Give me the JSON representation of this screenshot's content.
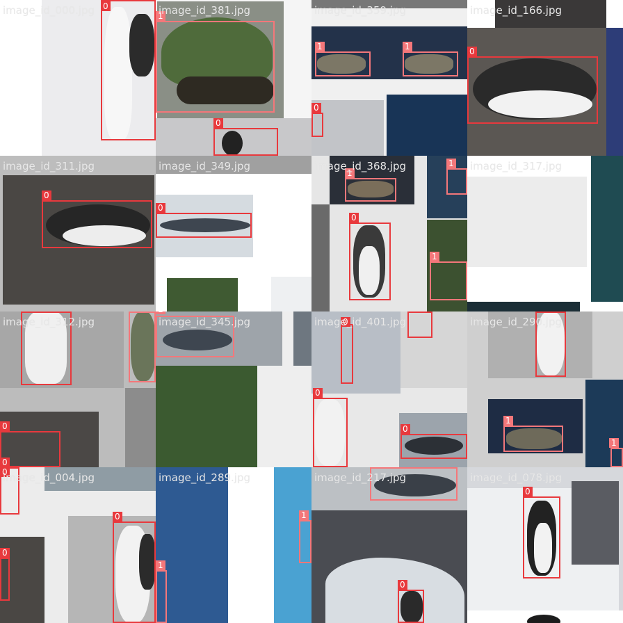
{
  "grid": {
    "tiles": [
      {
        "filename": "image_id_000.jpg"
      },
      {
        "filename": "image_id_381.jpg"
      },
      {
        "filename": "image_id_359.jpg"
      },
      {
        "filename": "image_id_166.jpg"
      },
      {
        "filename": "image_id_311.jpg"
      },
      {
        "filename": "image_id_349.jpg"
      },
      {
        "filename": "image_id_368.jpg"
      },
      {
        "filename": "image_id_317.jpg"
      },
      {
        "filename": "image_id_312.jpg"
      },
      {
        "filename": "image_id_345.jpg"
      },
      {
        "filename": "image_id_401.jpg"
      },
      {
        "filename": "image_id_290.jpg"
      },
      {
        "filename": "image_id_004.jpg"
      },
      {
        "filename": "image_id_289.jpg"
      },
      {
        "filename": "image_id_217.jpg"
      },
      {
        "filename": "image_id_078.jpg"
      }
    ]
  },
  "labels": {
    "penguin": "0",
    "turtle": "1"
  },
  "colors": {
    "penguin_box": "#e8393d",
    "turtle_box": "#f4777a",
    "filename_text": "#e8e8e8"
  }
}
